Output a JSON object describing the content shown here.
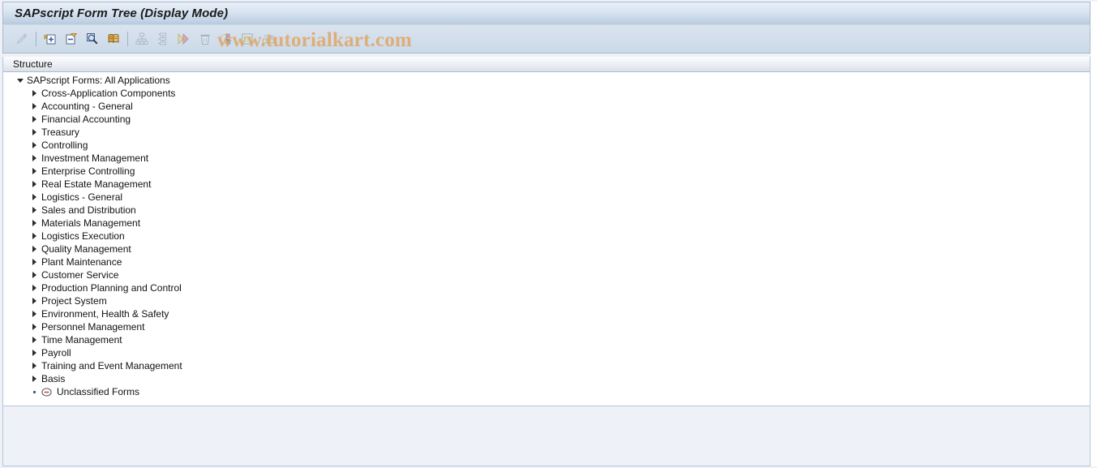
{
  "window": {
    "title": "SAPscript Form Tree (Display Mode)"
  },
  "watermark": {
    "text": "www.tutorialkart.com",
    "color": "#e0a86a"
  },
  "toolbar": {
    "buttons": [
      {
        "name": "display-change-icon",
        "title": "Display <-> Change",
        "enabled": false
      },
      {
        "name": "expand-node-icon",
        "title": "Expand Node",
        "enabled": true
      },
      {
        "name": "collapse-node-icon",
        "title": "Collapse Node",
        "enabled": true
      },
      {
        "name": "find-icon",
        "title": "Find",
        "enabled": true
      },
      {
        "name": "form-document-icon",
        "title": "Form",
        "enabled": true
      },
      {
        "name": "hierarchy-icon",
        "title": "Hierarchy",
        "enabled": false
      },
      {
        "name": "structure-icon",
        "title": "Structure",
        "enabled": false
      },
      {
        "name": "next-entry-icon",
        "title": "Next Entry",
        "enabled": false
      },
      {
        "name": "delete-trash-icon",
        "title": "Delete",
        "enabled": false
      },
      {
        "name": "select-cursor-icon",
        "title": "Select",
        "enabled": false
      },
      {
        "name": "table-grid-icon",
        "title": "Table",
        "enabled": false
      },
      {
        "name": "refresh-swap-icon",
        "title": "Refresh",
        "enabled": false
      }
    ]
  },
  "tree": {
    "column_header": "Structure",
    "root": {
      "label": "SAPscript Forms: All Applications",
      "expanded": true
    },
    "nodes": [
      {
        "label": "Cross-Application Components",
        "marker": "collapsed"
      },
      {
        "label": "Accounting - General",
        "marker": "collapsed"
      },
      {
        "label": "Financial Accounting",
        "marker": "collapsed"
      },
      {
        "label": "Treasury",
        "marker": "collapsed"
      },
      {
        "label": "Controlling",
        "marker": "collapsed"
      },
      {
        "label": "Investment Management",
        "marker": "collapsed"
      },
      {
        "label": "Enterprise Controlling",
        "marker": "collapsed"
      },
      {
        "label": "Real Estate Management",
        "marker": "collapsed"
      },
      {
        "label": "Logistics - General",
        "marker": "collapsed"
      },
      {
        "label": "Sales and Distribution",
        "marker": "collapsed"
      },
      {
        "label": "Materials Management",
        "marker": "collapsed"
      },
      {
        "label": "Logistics Execution",
        "marker": "collapsed"
      },
      {
        "label": "Quality Management",
        "marker": "collapsed"
      },
      {
        "label": "Plant Maintenance",
        "marker": "collapsed"
      },
      {
        "label": "Customer Service",
        "marker": "collapsed"
      },
      {
        "label": "Production Planning and Control",
        "marker": "collapsed"
      },
      {
        "label": "Project System",
        "marker": "collapsed"
      },
      {
        "label": "Environment, Health & Safety",
        "marker": "collapsed"
      },
      {
        "label": "Personnel Management",
        "marker": "collapsed"
      },
      {
        "label": "Time Management",
        "marker": "collapsed"
      },
      {
        "label": "Payroll",
        "marker": "collapsed"
      },
      {
        "label": "Training and Event Management",
        "marker": "collapsed"
      },
      {
        "label": "Basis",
        "marker": "collapsed"
      },
      {
        "label": "Unclassified Forms",
        "marker": "leaf-empty"
      }
    ]
  }
}
